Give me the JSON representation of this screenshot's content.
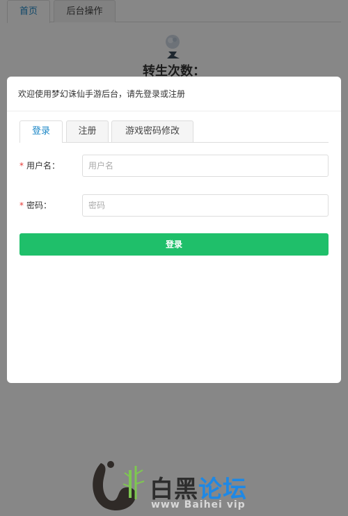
{
  "nav": {
    "tabs": [
      {
        "label": "首页",
        "active": true
      },
      {
        "label": "后台操作",
        "active": false
      }
    ]
  },
  "page": {
    "rebirth_label": "转生次数："
  },
  "modal": {
    "welcome_text": "欢迎使用梦幻诛仙手游后台，请先登录或注册",
    "tabs": [
      {
        "label": "登录",
        "active": true
      },
      {
        "label": "注册",
        "active": false
      },
      {
        "label": "游戏密码修改",
        "active": false
      }
    ],
    "form": {
      "required_mark": "*",
      "username_label": "用户名：",
      "username_placeholder": "用户名",
      "username_value": "",
      "password_label": "密码：",
      "password_placeholder": "密码",
      "password_value": "",
      "submit_label": "登录"
    }
  },
  "watermark": {
    "brand_dark": "白黑",
    "brand_blue": "论坛",
    "sub": "www Baihei vip"
  },
  "colors": {
    "accent": "#1e88c7",
    "primary_button": "#1fbf6a",
    "required": "#e53935",
    "overlay": "rgba(0,0,0,0.47)"
  }
}
